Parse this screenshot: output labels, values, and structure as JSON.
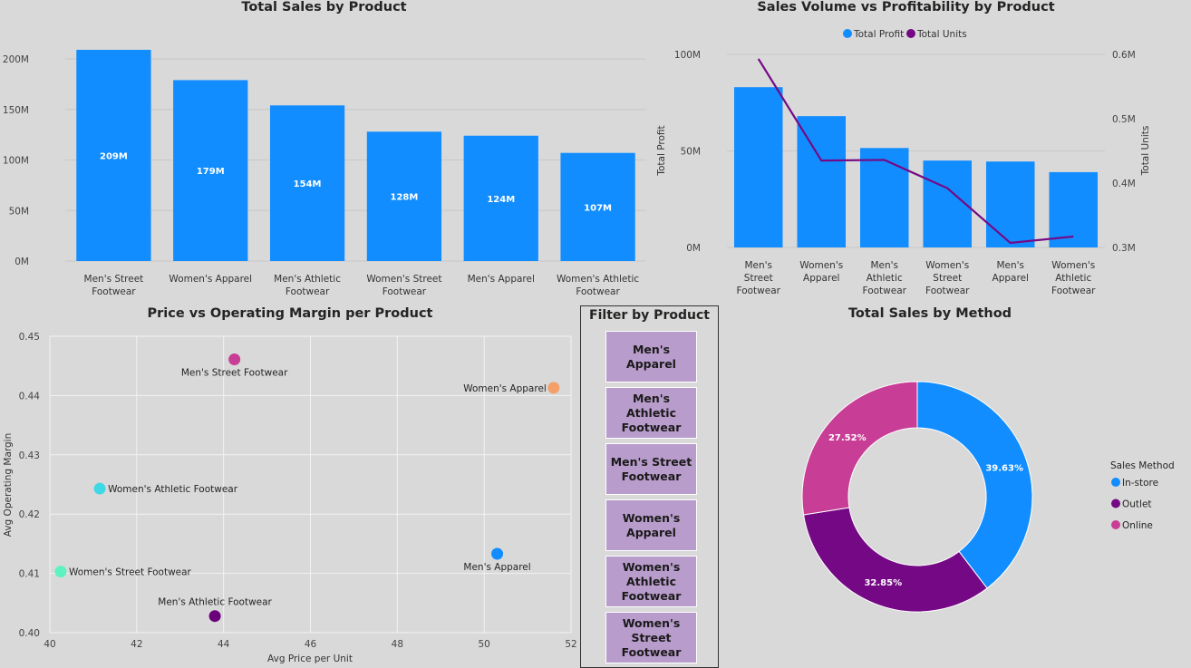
{
  "colors": {
    "blue": "#118DFF",
    "purple": "#750985",
    "pink": "#C83D95",
    "orange": "#F4A06A",
    "teal": "#41D8E6",
    "mint": "#5EF2C0",
    "violet": "#6B007B",
    "slicer_fill": "#B89CCB"
  },
  "slicer": {
    "title": "Filter by Product",
    "items": [
      "Men's Apparel",
      "Men's Athletic\nFootwear",
      "Men's Street\nFootwear",
      "Women's\nApparel",
      "Women's\nAthletic\nFootwear",
      "Women's\nStreet\nFootwear"
    ]
  },
  "chart_data": [
    {
      "id": "sales_by_product",
      "type": "bar",
      "title": "Total Sales by Product",
      "categories": [
        "Men's Street Footwear",
        "Women's Apparel",
        "Men's Athletic Footwear",
        "Women's Street Footwear",
        "Men's Apparel",
        "Women's Athletic Footwear"
      ],
      "category_lines": [
        [
          "Men's Street",
          "Footwear"
        ],
        [
          "Women's Apparel"
        ],
        [
          "Men's Athletic",
          "Footwear"
        ],
        [
          "Women's Street",
          "Footwear"
        ],
        [
          "Men's Apparel"
        ],
        [
          "Women's Athletic",
          "Footwear"
        ]
      ],
      "values": [
        209,
        179,
        154,
        128,
        124,
        107
      ],
      "data_labels": [
        "209M",
        "179M",
        "154M",
        "128M",
        "124M",
        "107M"
      ],
      "yticks": [
        0,
        50,
        100,
        150,
        200
      ],
      "ytick_labels": [
        "0M",
        "50M",
        "100M",
        "150M",
        "200M"
      ],
      "ylim": [
        0,
        215
      ],
      "grid": true
    },
    {
      "id": "volume_vs_profit",
      "type": "bar+line",
      "title": "Sales Volume vs Profitability by Product",
      "legend": [
        "Total Profit",
        "Total Units"
      ],
      "legend_position": "top-center",
      "categories": [
        "Men's Street Footwear",
        "Women's Apparel",
        "Men's Athletic Footwear",
        "Women's Street Footwear",
        "Men's Apparel",
        "Women's Athletic Footwear"
      ],
      "category_lines": [
        [
          "Men's",
          "Street",
          "Footwear"
        ],
        [
          "Women's",
          "Apparel"
        ],
        [
          "Men's",
          "Athletic",
          "Footwear"
        ],
        [
          "Women's",
          "Street",
          "Footwear"
        ],
        [
          "Men's",
          "Apparel"
        ],
        [
          "Women's",
          "Athletic",
          "Footwear"
        ]
      ],
      "series": [
        {
          "name": "Total Profit",
          "type": "bar",
          "axis": "left",
          "values": [
            83,
            68,
            51.5,
            45,
            44.5,
            39
          ]
        },
        {
          "name": "Total Units",
          "type": "line",
          "axis": "right",
          "values": [
            0.593,
            0.435,
            0.436,
            0.392,
            0.307,
            0.317
          ]
        }
      ],
      "ylabel_left": "Total Profit",
      "ylabel_right": "Total Units",
      "ylim_left": [
        0,
        100
      ],
      "ylim_right": [
        0.3,
        0.6
      ],
      "yticks_left": [
        0,
        50,
        100
      ],
      "ytick_labels_left": [
        "0M",
        "50M",
        "100M"
      ],
      "yticks_right": [
        0.3,
        0.4,
        0.5,
        0.6
      ],
      "ytick_labels_right": [
        "0.3M",
        "0.4M",
        "0.5M",
        "0.6M"
      ],
      "grid": true
    },
    {
      "id": "price_vs_margin",
      "type": "scatter",
      "title": "Price vs Operating Margin per Product",
      "xlabel": "Avg Price per Unit",
      "ylabel": "Avg Operating Margin",
      "xlim": [
        40,
        52
      ],
      "ylim": [
        0.4,
        0.45
      ],
      "xticks": [
        40,
        42,
        44,
        46,
        48,
        50,
        52
      ],
      "xtick_labels": [
        "40",
        "42",
        "44",
        "46",
        "48",
        "50",
        "52"
      ],
      "yticks": [
        0.4,
        0.41,
        0.42,
        0.43,
        0.44,
        0.45
      ],
      "ytick_labels": [
        "0.40",
        "0.41",
        "0.42",
        "0.43",
        "0.44",
        "0.45"
      ],
      "grid": true,
      "points": [
        {
          "label": "Men's Street Footwear",
          "x": 44.25,
          "y": 0.4461,
          "color": "#C83D95",
          "label_pos": "below"
        },
        {
          "label": "Women's Apparel",
          "x": 51.6,
          "y": 0.4413,
          "color": "#F4A06A",
          "label_pos": "left"
        },
        {
          "label": "Women's Athletic Footwear",
          "x": 41.15,
          "y": 0.4243,
          "color": "#41D8E6",
          "label_pos": "right"
        },
        {
          "label": "Men's Apparel",
          "x": 50.3,
          "y": 0.4133,
          "color": "#118DFF",
          "label_pos": "below"
        },
        {
          "label": "Women's Street Footwear",
          "x": 40.25,
          "y": 0.4103,
          "color": "#5EF2C0",
          "label_pos": "right"
        },
        {
          "label": "Men's Athletic Footwear",
          "x": 43.8,
          "y": 0.4028,
          "color": "#6B007B",
          "label_pos": "above"
        }
      ]
    },
    {
      "id": "sales_by_method",
      "type": "pie",
      "donut": true,
      "title": "Total Sales by Method",
      "legend_title": "Sales Method",
      "legend_position": "right",
      "slices": [
        {
          "label": "In-store",
          "value": 39.63,
          "display": "39.63%",
          "color": "#118DFF"
        },
        {
          "label": "Outlet",
          "value": 32.85,
          "display": "32.85%",
          "color": "#750985"
        },
        {
          "label": "Online",
          "value": 27.52,
          "display": "27.52%",
          "color": "#C83D95"
        }
      ]
    }
  ]
}
